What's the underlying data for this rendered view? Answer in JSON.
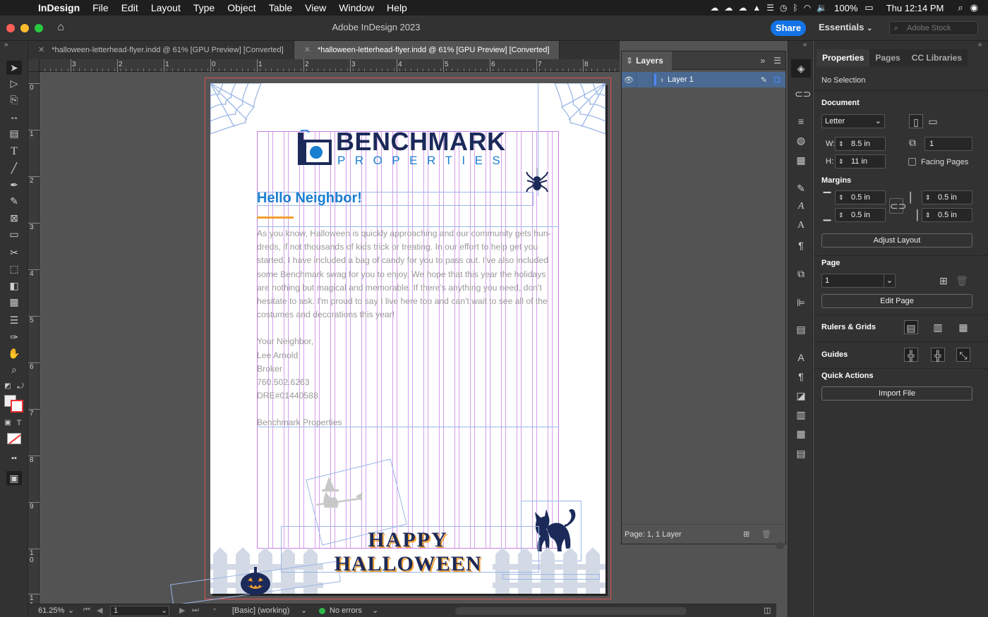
{
  "menubar": {
    "app_name": "InDesign",
    "menus": [
      "File",
      "Edit",
      "Layout",
      "Type",
      "Object",
      "Table",
      "View",
      "Window",
      "Help"
    ],
    "battery": "100%",
    "clock": "Thu 12:14 PM"
  },
  "titlebar": {
    "title": "Adobe InDesign 2023",
    "share_label": "Share",
    "workspace": "Essentials",
    "stock_placeholder": "Adobe Stock"
  },
  "tabs": [
    {
      "label": "*halloween-letterhead-flyer.indd @ 61% [GPU Preview] [Converted]",
      "active": false
    },
    {
      "label": "*halloween-letterhead-flyer.indd @ 61% [GPU Preview] [Converted]",
      "active": true
    }
  ],
  "rulers": {
    "horizontal": [
      "3",
      "2",
      "1",
      "0",
      "1",
      "2",
      "3",
      "4",
      "5",
      "6",
      "7",
      "8"
    ],
    "vertical": [
      "0",
      "1",
      "2",
      "3",
      "4",
      "5",
      "6",
      "7",
      "8",
      "9",
      "1 0",
      "1 1"
    ]
  },
  "page": {
    "logo_main": "BENCHMARK",
    "logo_sub": "PROPERTIES",
    "heading": "Hello Neighbor!",
    "body_lines": [
      "As you know, Halloween is quickly approaching and our community gets hun-",
      "dreds, if not thousands of kids trick or treating. In our effort to help get you",
      "started, I have included a bag of candy for you to pass out. I've also included",
      "some Benchmark swag for you to enjoy. We hope that this year the holidays",
      "are nothing but magical and memorable. If there's anything you need, don't",
      "hesitate to ask. I'm proud to say I live here too and can't wait to see all of the",
      "costumes and decorations this year!"
    ],
    "signature": [
      "Your Neighbor,",
      "Lee Arnold",
      "Broker",
      "760.502.6263",
      "DRE#01440588"
    ],
    "company": "Benchmark Properties",
    "happy": "HAPPY",
    "halloween": "HALLOWEEN",
    "colors": {
      "navy": "#1c2a5a",
      "blue": "#1a7fd0",
      "orange": "#f0a030",
      "guide": "#c77ee6"
    }
  },
  "status": {
    "zoom": "61.25%",
    "page": "1",
    "style": "[Basic] (working)",
    "preflight": "No errors"
  },
  "layers": {
    "title": "Layers",
    "layer_name": "Layer 1",
    "footer": "Page: 1, 1 Layer"
  },
  "properties": {
    "tabs": [
      "Properties",
      "Pages",
      "CC Libraries"
    ],
    "selection": "No Selection",
    "document_label": "Document",
    "preset": "Letter",
    "width_label": "W:",
    "width": "8.5 in",
    "height_label": "H:",
    "height": "11 in",
    "pages_count": "1",
    "facing_pages": "Facing Pages",
    "margins_label": "Margins",
    "margin_top": "0.5 in",
    "margin_bottom": "0.5 in",
    "margin_left": "0.5 in",
    "margin_right": "0.5 in",
    "adjust_layout": "Adjust Layout",
    "page_label": "Page",
    "page_value": "1",
    "edit_page": "Edit Page",
    "rulers_grids": "Rulers & Grids",
    "guides": "Guides",
    "quick_actions": "Quick Actions",
    "import_file": "Import File"
  }
}
